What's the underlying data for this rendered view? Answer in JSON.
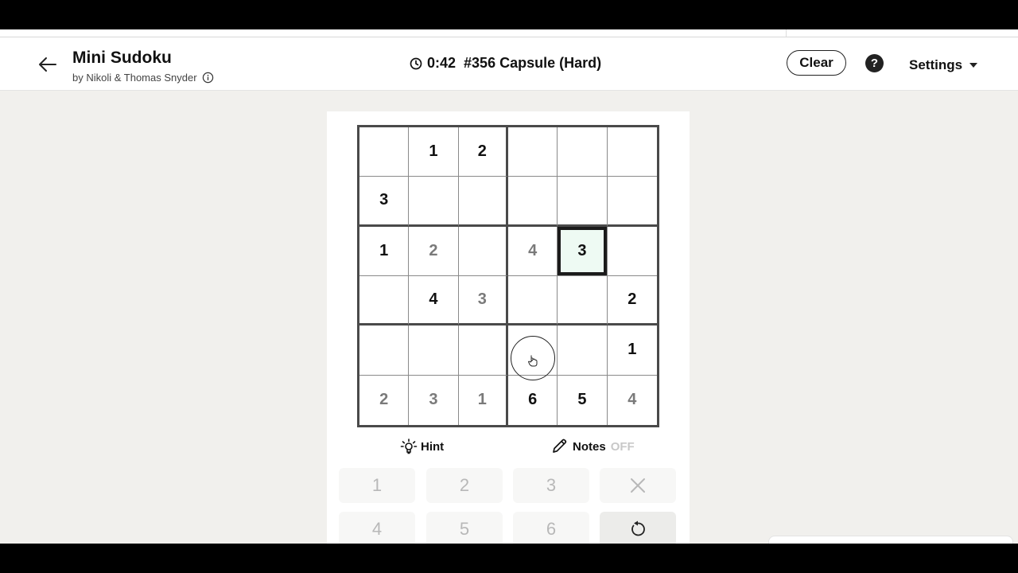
{
  "header": {
    "back_icon": "arrow-left-icon",
    "title": "Mini Sudoku",
    "byline": "by Nikoli & Thomas Snyder",
    "info_icon": "info-icon",
    "timer_icon": "clock-icon",
    "timer": "0:42",
    "puzzle": "#356 Capsule (Hard)",
    "clear_label": "Clear",
    "help_label": "?",
    "settings_label": "Settings"
  },
  "board": {
    "size": 6,
    "cells": [
      [
        {
          "v": "",
          "t": ""
        },
        {
          "v": "1",
          "t": "given"
        },
        {
          "v": "2",
          "t": "given"
        },
        {
          "v": "",
          "t": ""
        },
        {
          "v": "",
          "t": ""
        },
        {
          "v": "",
          "t": ""
        }
      ],
      [
        {
          "v": "3",
          "t": "given"
        },
        {
          "v": "",
          "t": ""
        },
        {
          "v": "",
          "t": ""
        },
        {
          "v": "",
          "t": ""
        },
        {
          "v": "",
          "t": ""
        },
        {
          "v": "",
          "t": ""
        }
      ],
      [
        {
          "v": "1",
          "t": "given"
        },
        {
          "v": "2",
          "t": "user"
        },
        {
          "v": "",
          "t": ""
        },
        {
          "v": "4",
          "t": "user"
        },
        {
          "v": "3",
          "t": "given",
          "selected": true
        },
        {
          "v": "",
          "t": ""
        }
      ],
      [
        {
          "v": "",
          "t": ""
        },
        {
          "v": "4",
          "t": "given"
        },
        {
          "v": "3",
          "t": "user"
        },
        {
          "v": "",
          "t": ""
        },
        {
          "v": "",
          "t": ""
        },
        {
          "v": "2",
          "t": "given"
        }
      ],
      [
        {
          "v": "",
          "t": ""
        },
        {
          "v": "",
          "t": ""
        },
        {
          "v": "",
          "t": ""
        },
        {
          "v": "",
          "t": ""
        },
        {
          "v": "",
          "t": ""
        },
        {
          "v": "1",
          "t": "given"
        }
      ],
      [
        {
          "v": "2",
          "t": "user"
        },
        {
          "v": "3",
          "t": "user"
        },
        {
          "v": "1",
          "t": "user"
        },
        {
          "v": "6",
          "t": "given"
        },
        {
          "v": "5",
          "t": "given"
        },
        {
          "v": "4",
          "t": "user"
        }
      ]
    ],
    "selected_color": "#eefaf3"
  },
  "tools": {
    "hint_label": "Hint",
    "hint_icon": "lightbulb-icon",
    "notes_label": "Notes",
    "notes_state": "OFF",
    "notes_icon": "pencil-icon"
  },
  "keypad": {
    "row1": [
      "1",
      "2",
      "3"
    ],
    "row2": [
      "4",
      "5",
      "6"
    ],
    "erase_icon": "close-icon",
    "undo_icon": "undo-icon"
  }
}
